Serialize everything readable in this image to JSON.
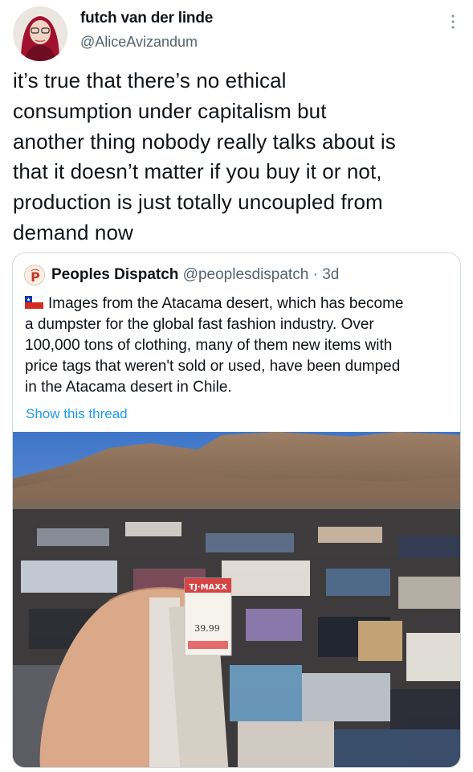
{
  "author": {
    "display_name": "futch van der linde",
    "handle": "@AliceAvizandum"
  },
  "tweet": {
    "lines": [
      "it’s true that there’s no ethical",
      "consumption under capitalism but",
      "another thing nobody really talks about is",
      "that it doesn’t matter if you buy it or not,",
      "production is just totally uncoupled from",
      "demand now"
    ]
  },
  "quoted": {
    "display_name": "Peoples Dispatch",
    "handle": "@peoplesdispatch",
    "separator": "·",
    "time": "3d",
    "lines": [
      "Images from the Atacama desert, which has become",
      "a dumpster for the global fast fashion industry. Over",
      "100,000 tons of clothing, many of them new items with",
      "price tags that weren't sold or used, have been dumped",
      "in the Atacama desert in Chile."
    ],
    "show_thread": "Show this thread",
    "photo": {
      "tag_brand": "TJ·MAXX",
      "tag_price": "39.99"
    }
  },
  "colors": {
    "link": "#1d9bf0",
    "secondary_text": "#536471",
    "border": "#cfd9de"
  },
  "icons": {
    "more": "more-vertical-icon",
    "flag": "chile-flag-icon"
  }
}
